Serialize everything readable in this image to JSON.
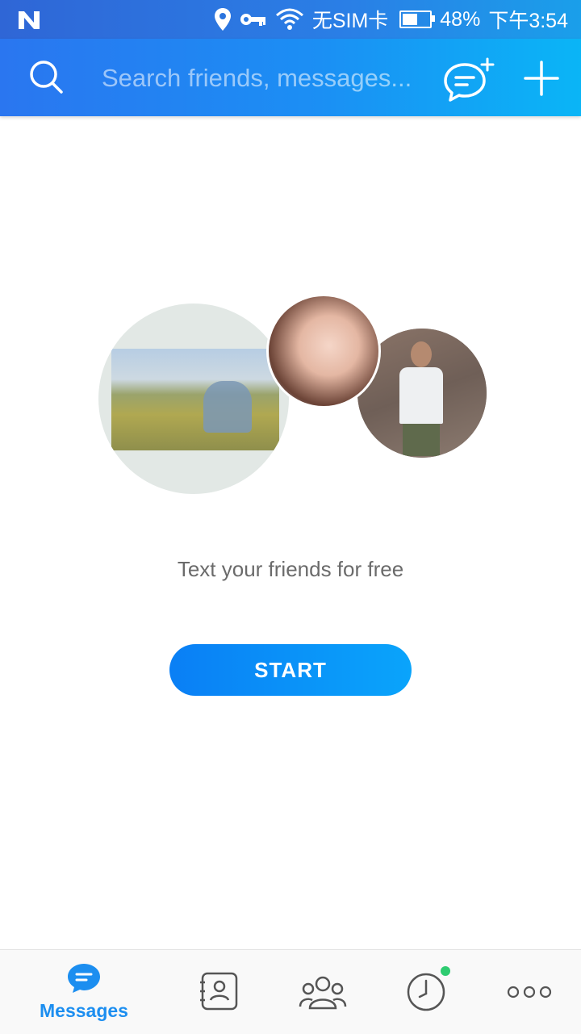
{
  "status_bar": {
    "carrier": "无SIM卡",
    "battery": "48%",
    "time": "下午3:54",
    "icons": [
      "n-logo-icon",
      "location-icon",
      "key-icon",
      "wifi-icon",
      "battery-icon"
    ]
  },
  "app_bar": {
    "search_placeholder": "Search friends, messages...",
    "icons": [
      "search-icon",
      "new-chat-icon",
      "plus-icon"
    ]
  },
  "main": {
    "tagline": "Text your friends for free",
    "start_label": "START"
  },
  "bottom_nav": {
    "tabs": [
      {
        "label": "Messages",
        "icon": "messages-icon",
        "active": true
      },
      {
        "label": "",
        "icon": "contacts-icon",
        "active": false
      },
      {
        "label": "",
        "icon": "group-icon",
        "active": false
      },
      {
        "label": "",
        "icon": "timeline-icon",
        "active": false,
        "badge": true
      },
      {
        "label": "",
        "icon": "more-icon",
        "active": false
      }
    ]
  },
  "colors": {
    "accent": "#1c8ef0",
    "appbar_start": "#2a76f0",
    "appbar_end": "#0ab5f6",
    "badge": "#2ecc71",
    "icon_gray": "#555555"
  }
}
